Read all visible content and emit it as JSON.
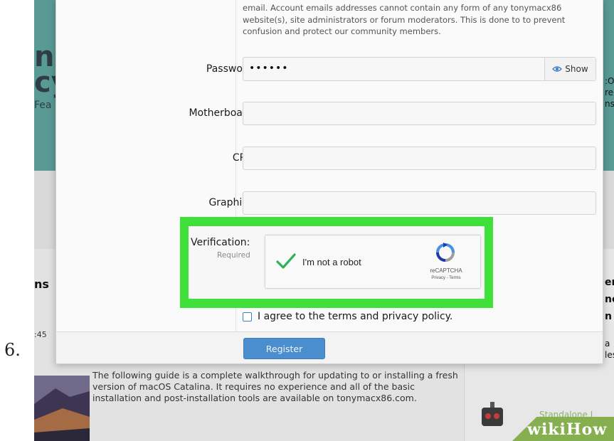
{
  "step_number": "6.",
  "background": {
    "hero_left_text": "n\ncy",
    "hero_left_sub": "Fea",
    "left_heading": "ns",
    "left_time": ":45",
    "right_texts": [
      ":O",
      "re",
      "nst",
      "era",
      "ne",
      "n i",
      "a",
      "les"
    ],
    "guide_text": "The following guide is a complete walkthrough for updating to or installing a fresh version of macOS Catalina. It requires no experience and all of the basic installation and post-installation tools are available on tonymacx86.com.",
    "standalone_text": "Standalone I",
    "watermark": "wikiHow"
  },
  "dialog": {
    "notice_text": "email. Account emails addresses cannot contain any form of any tonymacx86 website(s), site administrators or forum moderators. This is done to to prevent confusion and protect our community members.",
    "password": {
      "label": "Password:",
      "value": "••••••",
      "show_label": "Show"
    },
    "motherboard": {
      "label": "Motherboard:",
      "value": ""
    },
    "cpu": {
      "label": "CPU:",
      "value": ""
    },
    "graphics": {
      "label": "Graphics:",
      "value": ""
    },
    "verification": {
      "label": "Verification:",
      "required_note": "Required",
      "captcha_label": "I'm not a robot",
      "captcha_brand": "reCAPTCHA",
      "captcha_links": "Privacy - Terms",
      "checked": true
    },
    "agree_label": "I agree to the terms and privacy policy.",
    "register_label": "Register"
  },
  "colors": {
    "highlight": "#3fe03a",
    "primary_button": "#4b8ecd",
    "check": "#2fb35a"
  }
}
